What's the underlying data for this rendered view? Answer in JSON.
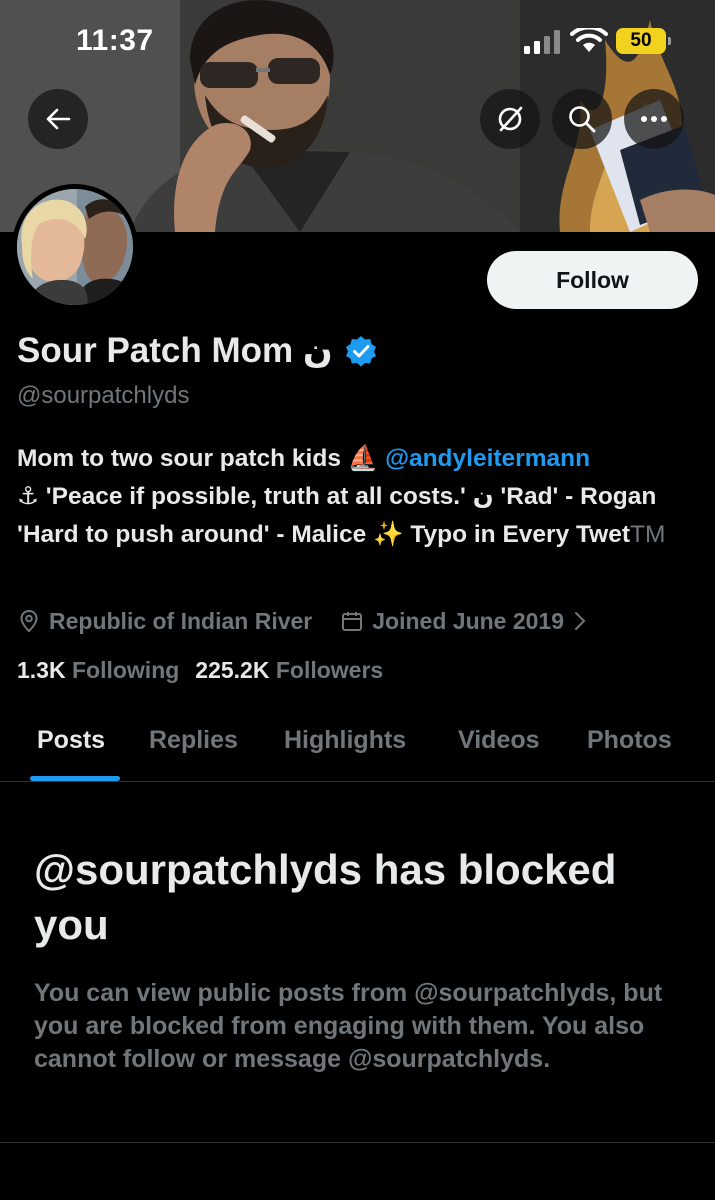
{
  "status_bar": {
    "time": "11:37",
    "battery": "50"
  },
  "profile": {
    "display_name": "Sour Patch Mom ن",
    "handle": "@sourpatchlyds",
    "follow_label": "Follow",
    "bio": {
      "line1_text": "Mom to two sour patch kids ⛵ ",
      "mention": "@andyleitermann",
      "line2_text": "⚓ 'Peace if possible, truth at all costs.' ن 'Rad' - Rogan 'Hard to push around' - Malice ✨ Typo in Every Twet",
      "trademark": "TM"
    },
    "location": "Republic of Indian River",
    "joined": "Joined June 2019",
    "following_count": "1.3K",
    "following_label": "Following",
    "followers_count": "225.2K",
    "followers_label": "Followers"
  },
  "tabs": [
    {
      "label": "Posts",
      "active": true
    },
    {
      "label": "Replies"
    },
    {
      "label": "Highlights"
    },
    {
      "label": "Videos"
    },
    {
      "label": "Photos"
    }
  ],
  "blocked": {
    "title": "@sourpatchlyds has blocked you",
    "description": "You can view public posts from @sourpatchlyds, but you are blocked from engaging with them. You also cannot follow or message @sourpatchlyds."
  },
  "icons": {
    "back": "arrow-left-icon",
    "grok": "grok-icon",
    "search": "search-icon",
    "more": "more-horizontal-icon",
    "verified": "verified-badge-icon",
    "location": "location-pin-icon",
    "calendar": "calendar-icon",
    "chevron": "chevron-right-icon"
  },
  "colors": {
    "accent": "#1d9bf0",
    "background": "#000000",
    "muted": "#71767b",
    "battery": "#f1d21f"
  }
}
